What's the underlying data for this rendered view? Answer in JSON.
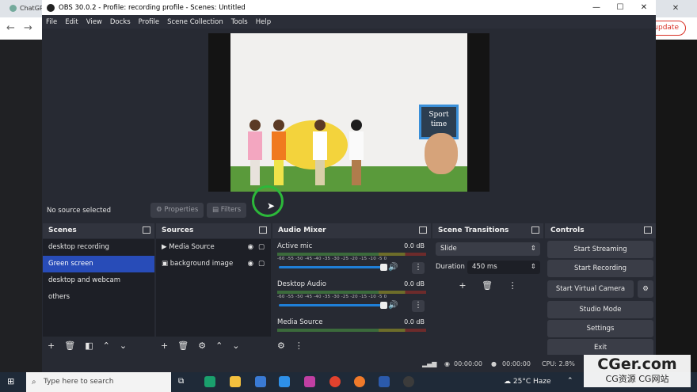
{
  "browser": {
    "tab_label": "ChatGP",
    "update_label": "update"
  },
  "window": {
    "title": "OBS 30.0.2 - Profile: recording profile - Scenes: Untitled",
    "min": "—",
    "max": "☐",
    "close": "✕"
  },
  "menu": [
    "File",
    "Edit",
    "View",
    "Docks",
    "Profile",
    "Scene Collection",
    "Tools",
    "Help"
  ],
  "preview": {
    "board_text_1": "Sport",
    "board_text_2": "time"
  },
  "source_bar": {
    "status": "No source selected",
    "properties": "Properties",
    "filters": "Filters"
  },
  "scenes": {
    "title": "Scenes",
    "items": [
      "desktop recording",
      "Green screen",
      "desktop and webcam",
      "others"
    ],
    "selected": 1
  },
  "sources": {
    "title": "Sources",
    "items": [
      "Media Source",
      "background image"
    ]
  },
  "mixer": {
    "title": "Audio Mixer",
    "ticks": "-60  -55  -50  -45  -40  -35  -30  -25  -20  -15  -10  -5  0",
    "channels": [
      {
        "name": "Active mic",
        "db": "0.0 dB"
      },
      {
        "name": "Desktop Audio",
        "db": "0.0 dB"
      },
      {
        "name": "Media Source",
        "db": "0.0 dB"
      }
    ]
  },
  "transitions": {
    "title": "Scene Transitions",
    "type": "Slide",
    "duration_label": "Duration",
    "duration_value": "450 ms"
  },
  "controls": {
    "title": "Controls",
    "start_streaming": "Start Streaming",
    "start_recording": "Start Recording",
    "start_virtual_camera": "Start Virtual Camera",
    "studio_mode": "Studio Mode",
    "settings": "Settings",
    "exit": "Exit"
  },
  "status": {
    "stream_time": "00:00:00",
    "record_time": "00:00:00",
    "cpu": "CPU: 2.8%"
  },
  "taskbar": {
    "search_placeholder": "Type here to search",
    "temperature": "25°C",
    "weather": "Haze"
  },
  "watermark": {
    "line1": "CGer.com",
    "line2": "CG资源 CG网站"
  }
}
